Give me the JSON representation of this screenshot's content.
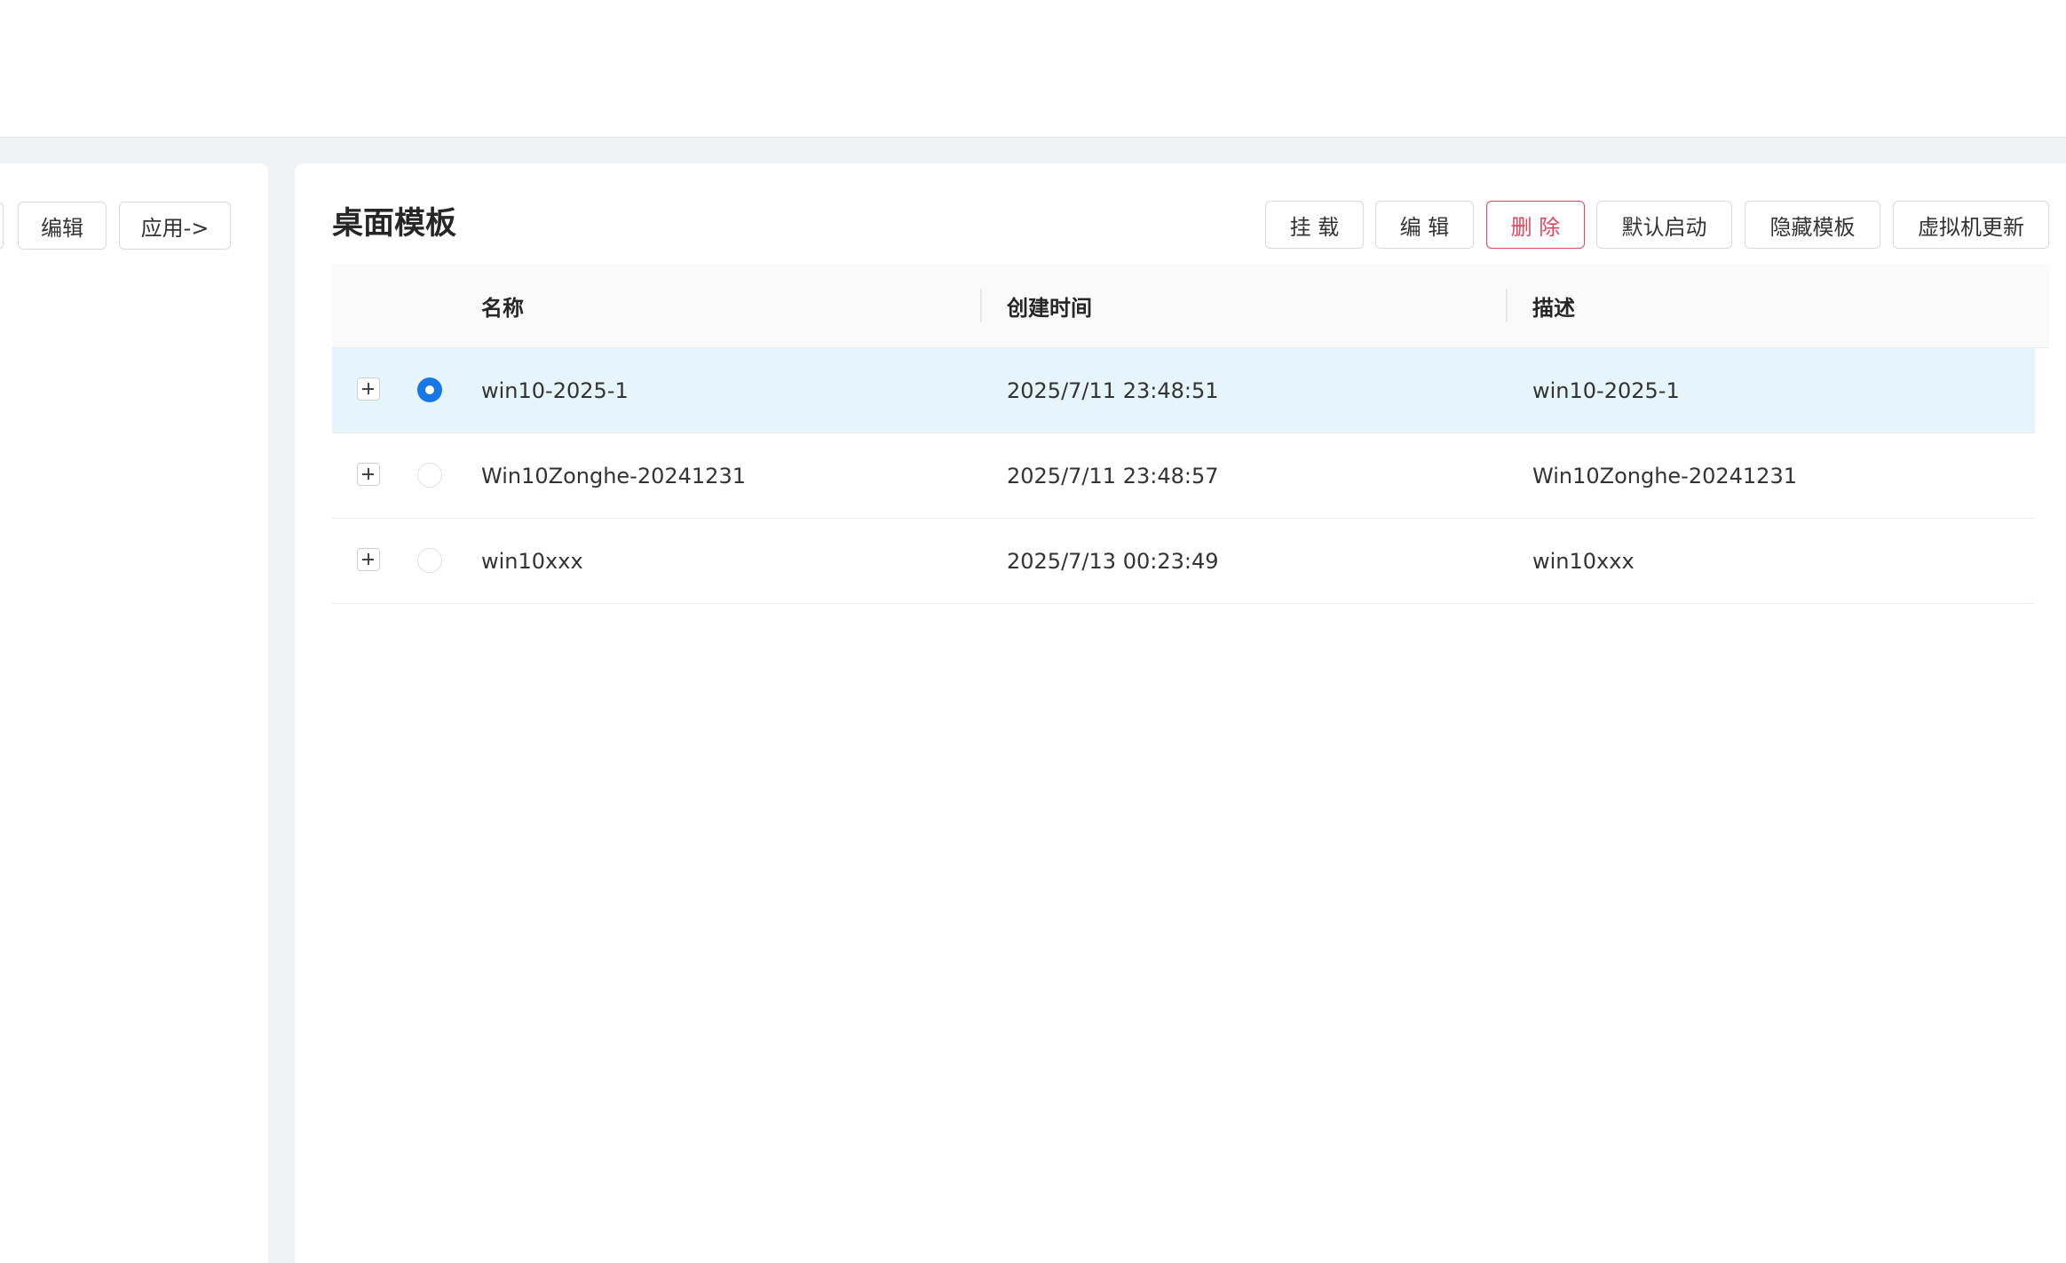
{
  "left_panel": {
    "edit_label": "编辑",
    "apply_label": "应用->"
  },
  "main": {
    "title": "桌面模板",
    "toolbar": [
      {
        "label": "挂 载",
        "variant": "default"
      },
      {
        "label": "编 辑",
        "variant": "default"
      },
      {
        "label": "删 除",
        "variant": "danger"
      },
      {
        "label": "默认启动",
        "variant": "default"
      },
      {
        "label": "隐藏模板",
        "variant": "default"
      },
      {
        "label": "虚拟机更新",
        "variant": "default"
      }
    ],
    "table": {
      "columns": [
        "名称",
        "创建时间",
        "描述"
      ],
      "rows": [
        {
          "name": "win10-2025-1",
          "created": "2025/7/11 23:48:51",
          "desc": "win10-2025-1",
          "selected": true
        },
        {
          "name": "Win10Zonghe-20241231",
          "created": "2025/7/11 23:48:57",
          "desc": "Win10Zonghe-20241231",
          "selected": false
        },
        {
          "name": "win10xxx",
          "created": "2025/7/13 00:23:49",
          "desc": "win10xxx",
          "selected": false
        }
      ]
    }
  },
  "colors": {
    "accent": "#1677e6",
    "danger": "#e0445e",
    "selected_row": "#e6f4fc",
    "page_background": "#f0f2f5"
  },
  "icons": {
    "expand": "plus-icon",
    "radio": "radio-icon"
  }
}
